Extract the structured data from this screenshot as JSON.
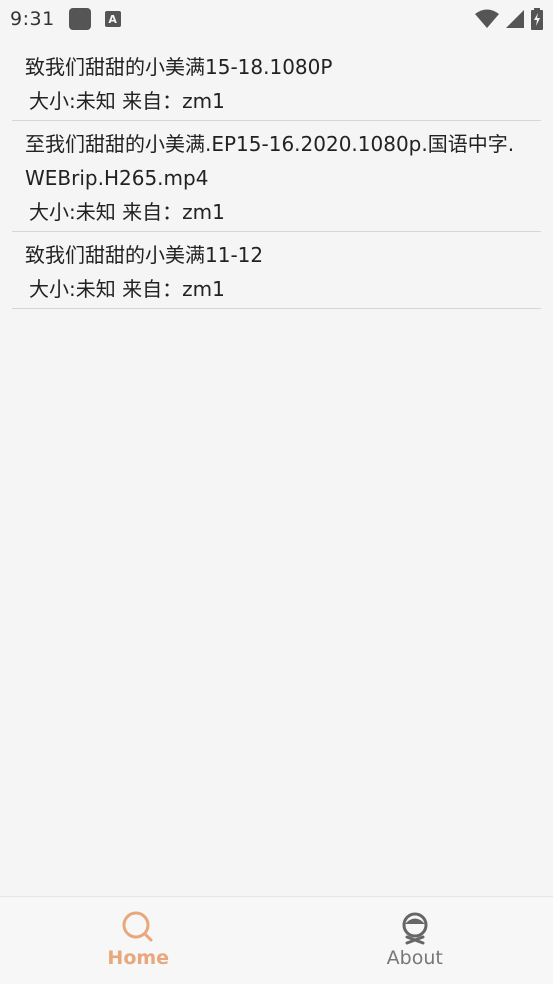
{
  "status_bar": {
    "time": "9:31",
    "icons": [
      "app-square-icon",
      "a-badge-icon",
      "wifi-icon",
      "signal-icon",
      "battery-icon"
    ],
    "a_badge": "A"
  },
  "results": [
    {
      "title": "致我们甜甜的小美满15-18.1080P",
      "size": "大小:未知",
      "source": "来自：zm1"
    },
    {
      "title": "至我们甜甜的小美满.EP15-16.2020.1080p.国语中字.WEBrip.H265.mp4",
      "size": "大小:未知",
      "source": "来自：zm1"
    },
    {
      "title": "致我们甜甜的小美满11-12",
      "size": "大小:未知",
      "source": "来自：zm1"
    }
  ],
  "bottom_nav": {
    "home_label": "Home",
    "about_label": "About",
    "active_color": "#e8a77c",
    "inactive_color": "#777777"
  }
}
